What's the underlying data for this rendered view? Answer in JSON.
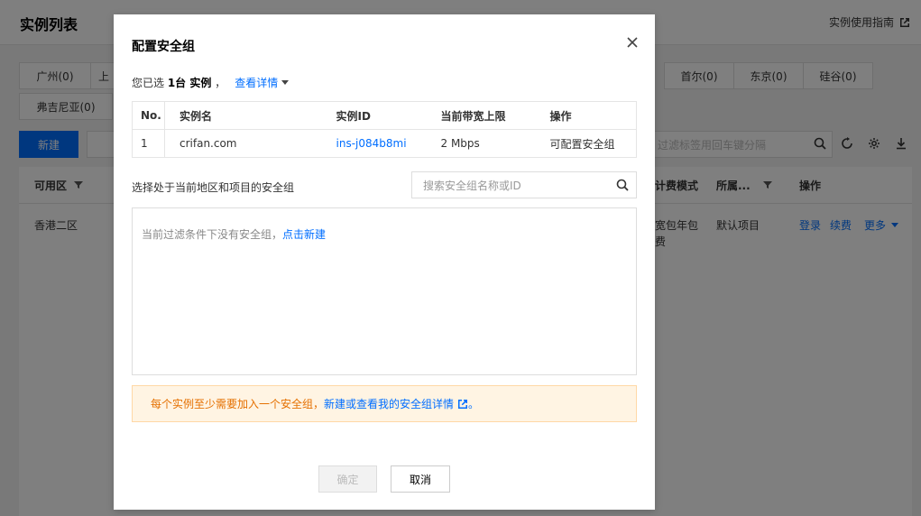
{
  "background": {
    "page_title": "实例列表",
    "guide_link": "实例使用指南",
    "regions_row1": [
      "广州(0)",
      "上",
      "首尔(0)",
      "东京(0)",
      "硅谷(0)"
    ],
    "regions_row2": [
      "弗吉尼亚(0)"
    ],
    "new_button": "新建",
    "search_placeholder": "过滤标签用回车键分隔",
    "table_headers": {
      "zone": "可用区",
      "billing": "计费模式",
      "project": "所属...",
      "ops": "操作"
    },
    "row": {
      "zone": "香港二区",
      "billing_line1": "宽包年包",
      "billing_line2": "费",
      "project": "默认项目",
      "op_login": "登录",
      "op_renew": "续费",
      "op_more": "更多"
    }
  },
  "dialog": {
    "title": "配置安全组",
    "selected_prefix": "您已选 ",
    "selected_count": "1台 实例",
    "selected_suffix": " ，",
    "view_details": "查看详情",
    "table": {
      "headers": [
        "No.",
        "实例名",
        "实例ID",
        "当前带宽上限",
        "操作"
      ],
      "rows": [
        [
          "1",
          "crifan.com",
          "ins-j084b8mi",
          "2 Mbps",
          "可配置安全组"
        ]
      ]
    },
    "sg_label": "选择处于当前地区和项目的安全组",
    "sg_search_placeholder": "搜索安全组名称或ID",
    "empty_text": "当前过滤条件下没有安全组，",
    "empty_link": "点击新建",
    "notice_text": "每个实例至少需要加入一个安全组，",
    "notice_link": "新建或查看我的安全组详情",
    "notice_end": "。",
    "ok_button": "确定",
    "cancel_button": "取消"
  },
  "colors": {
    "accent": "#006eff",
    "notice_bg": "#fff4e3",
    "notice_text": "#e57000"
  }
}
